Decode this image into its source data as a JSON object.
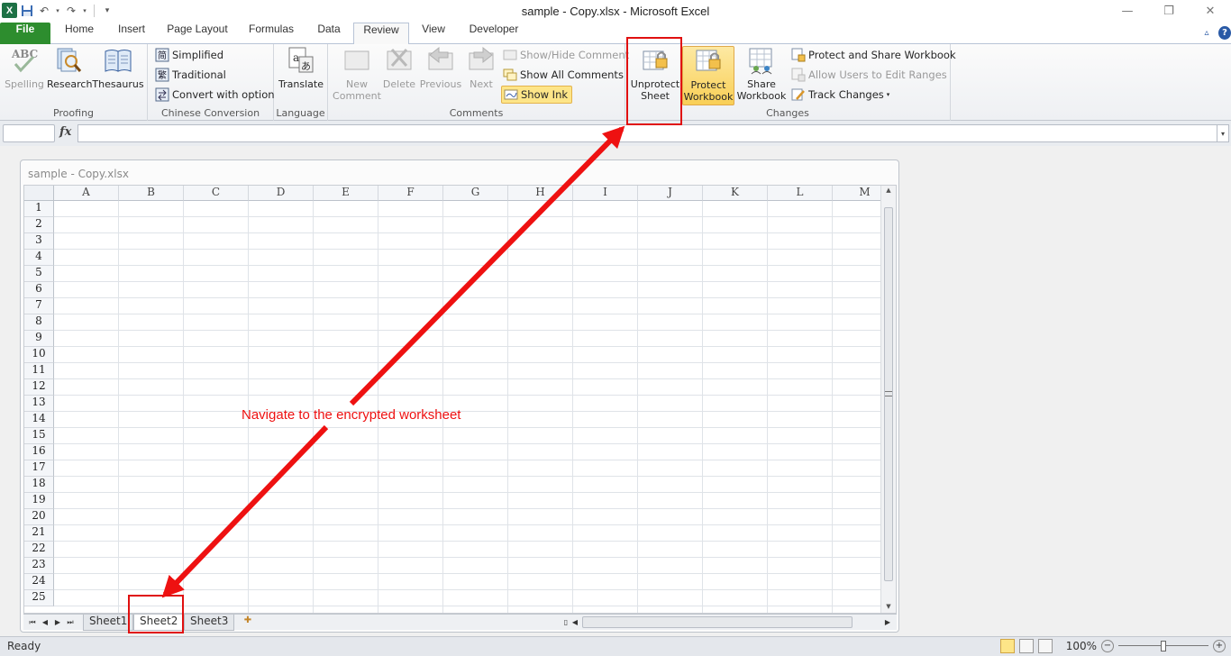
{
  "window": {
    "title": "sample -  Copy.xlsx  -  Microsoft Excel",
    "minimize": "—",
    "restore": "❐",
    "close": "✕"
  },
  "quick_access": {
    "logo": "X",
    "save_icon": "save-icon",
    "undo_icon": "undo-icon",
    "redo_icon": "redo-icon"
  },
  "tabs": [
    {
      "label": "File"
    },
    {
      "label": "Home"
    },
    {
      "label": "Insert"
    },
    {
      "label": "Page Layout"
    },
    {
      "label": "Formulas"
    },
    {
      "label": "Data"
    },
    {
      "label": "Review"
    },
    {
      "label": "View"
    },
    {
      "label": "Developer"
    }
  ],
  "active_tab": "Review",
  "ribbon": {
    "proofing": {
      "label": "Proofing",
      "spelling": "Spelling",
      "research": "Research",
      "thesaurus": "Thesaurus"
    },
    "chinese": {
      "label": "Chinese Conversion",
      "simplified": "Simplified",
      "traditional": "Traditional",
      "convert": "Convert with option"
    },
    "language": {
      "label": "Language",
      "translate": "Translate"
    },
    "comments": {
      "label": "Comments",
      "new_line1": "New",
      "new_line2": "Comment",
      "delete": "Delete",
      "previous": "Previous",
      "next": "Next",
      "show_hide": "Show/Hide Comment",
      "show_all": "Show All Comments",
      "show_ink": "Show Ink"
    },
    "changes": {
      "label": "Changes",
      "unprotect_line1": "Unprotect",
      "unprotect_line2": "Sheet",
      "protect_line1": "Protect",
      "protect_line2": "Workbook",
      "share_line1": "Share",
      "share_line2": "Workbook",
      "protect_share": "Protect and Share Workbook",
      "allow_users": "Allow Users to Edit Ranges",
      "track_changes": "Track Changes"
    }
  },
  "formula_bar": {
    "fx": "fx",
    "value": ""
  },
  "workbook": {
    "title": "sample -  Copy.xlsx",
    "columns": [
      "A",
      "B",
      "C",
      "D",
      "E",
      "F",
      "G",
      "H",
      "I",
      "J",
      "K",
      "L",
      "M"
    ],
    "rows": [
      "1",
      "2",
      "3",
      "4",
      "5",
      "6",
      "7",
      "8",
      "9",
      "10",
      "11",
      "12",
      "13",
      "14",
      "15",
      "16",
      "17",
      "18",
      "19",
      "20",
      "21",
      "22",
      "23",
      "24",
      "25"
    ],
    "sheets": [
      "Sheet1",
      "Sheet2",
      "Sheet3"
    ],
    "active_sheet": "Sheet2"
  },
  "status": {
    "text": "Ready",
    "zoom": "100%",
    "zoom_level_percent": 100
  },
  "annotation": {
    "text": "Navigate to the encrypted worksheet",
    "color": "#ee1111"
  }
}
